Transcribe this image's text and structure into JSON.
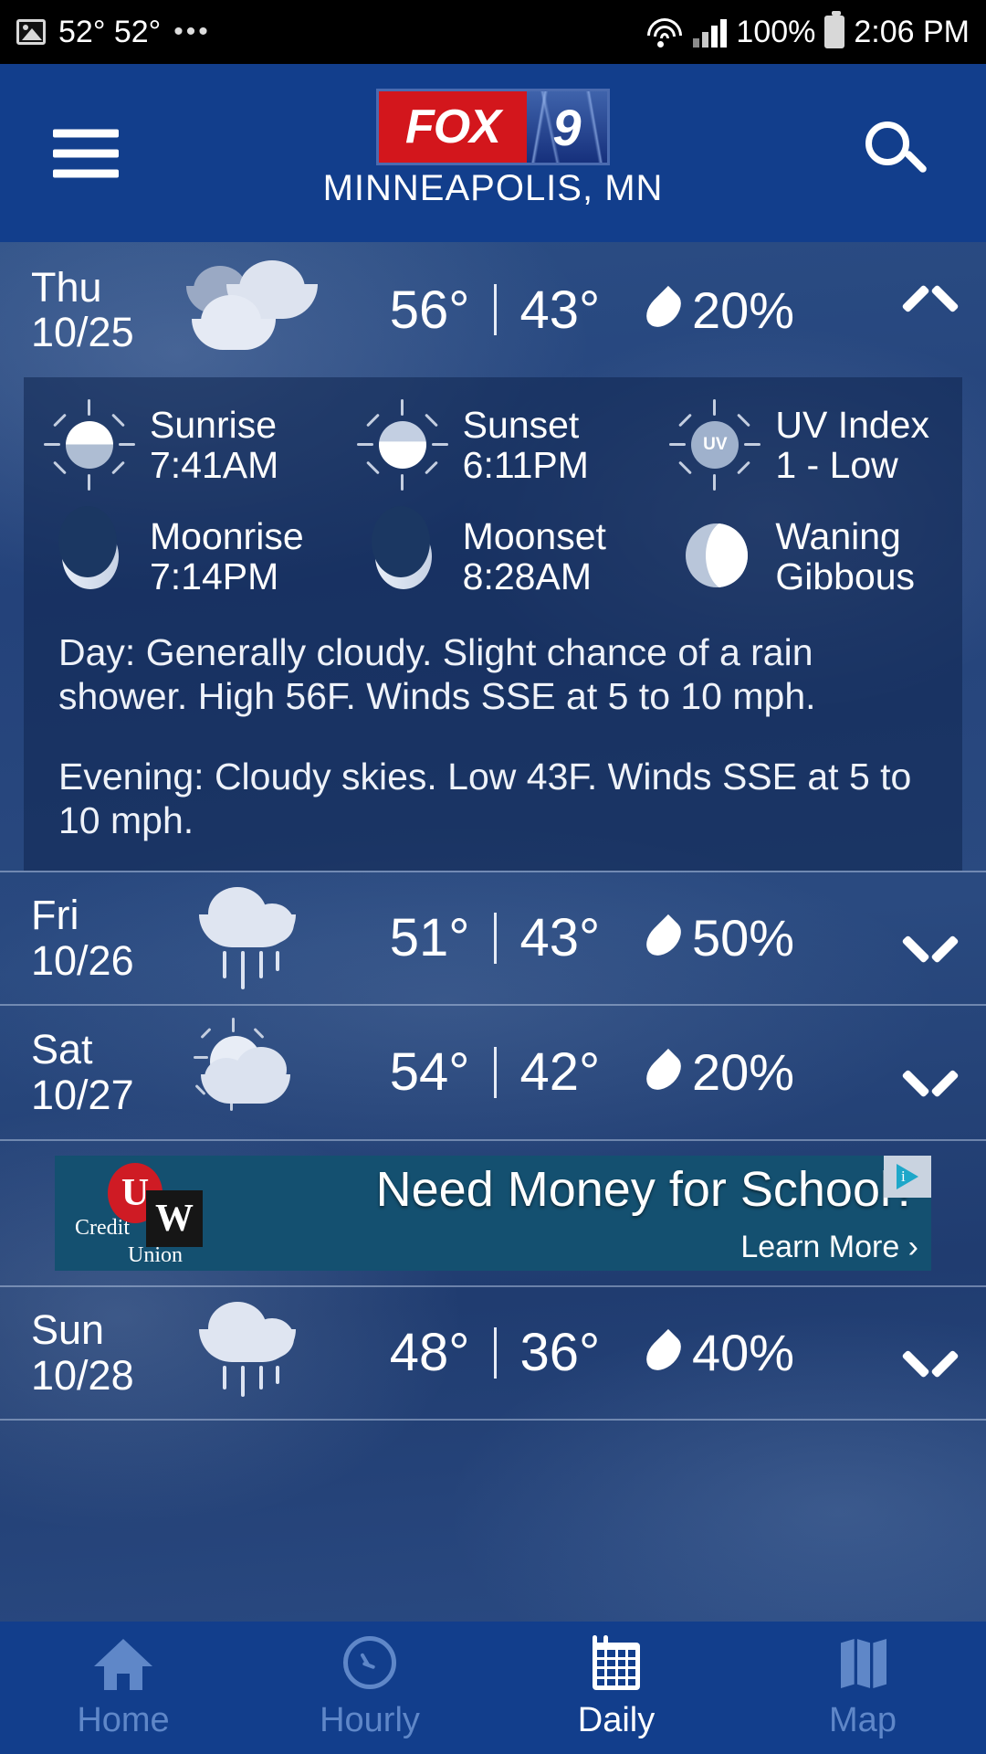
{
  "status_bar": {
    "image_icon": "image-icon",
    "temps": "52° 52°",
    "overflow": "•••",
    "wifi_icon": "wifi-icon",
    "signal_icon": "cell-signal-icon",
    "battery_percent": "100%",
    "battery_icon": "battery-icon",
    "time": "2:06 PM"
  },
  "header": {
    "menu_icon": "hamburger-menu-icon",
    "logo_fox": "FOX",
    "logo_nine": "9",
    "city": "MINNEAPOLIS, MN",
    "search_icon": "search-icon",
    "bg_color": "#123E8C"
  },
  "days": [
    {
      "dow": "Thu",
      "date": "10/25",
      "icon": "cloudy-icon",
      "high": "56°",
      "low": "43°",
      "separator": "|",
      "precip": "20%",
      "drop_icon": "water-drop-icon",
      "chevron": "chevron-up-icon",
      "expanded": true
    },
    {
      "dow": "Fri",
      "date": "10/26",
      "icon": "rain-cloud-icon",
      "high": "51°",
      "low": "43°",
      "separator": "|",
      "precip": "50%",
      "drop_icon": "water-drop-icon",
      "chevron": "chevron-down-icon",
      "expanded": false
    },
    {
      "dow": "Sat",
      "date": "10/27",
      "icon": "partly-sunny-icon",
      "high": "54°",
      "low": "42°",
      "separator": "|",
      "precip": "20%",
      "drop_icon": "water-drop-icon",
      "chevron": "chevron-down-icon",
      "expanded": false
    },
    {
      "dow": "Sun",
      "date": "10/28",
      "icon": "rain-cloud-icon",
      "high": "48°",
      "low": "36°",
      "separator": "|",
      "precip": "40%",
      "drop_icon": "water-drop-icon",
      "chevron": "chevron-down-icon",
      "expanded": false
    }
  ],
  "detail": {
    "astro": [
      {
        "label": "Sunrise",
        "value": "7:41AM",
        "icon": "sunrise-icon"
      },
      {
        "label": "Sunset",
        "value": "6:11PM",
        "icon": "sunset-icon"
      },
      {
        "label": "UV Index",
        "value": "1 - Low",
        "icon": "uv-index-icon",
        "badge": "UV"
      },
      {
        "label": "Moonrise",
        "value": "7:14PM",
        "icon": "moonrise-icon"
      },
      {
        "label": "Moonset",
        "value": "8:28AM",
        "icon": "moonset-icon"
      },
      {
        "label": "Waning",
        "value": "Gibbous",
        "icon": "moon-phase-icon"
      }
    ],
    "day_forecast": "Day: Generally cloudy. Slight chance of a rain shower. High 56F. Winds SSE at 5 to 10 mph.",
    "evening_forecast": "Evening: Cloudy skies. Low 43F. Winds SSE at 5 to 10 mph."
  },
  "ad": {
    "brand_u": "U",
    "brand_w": "W",
    "brand_credit": "Credit",
    "brand_union": "Union",
    "headline": "Need Money for School?",
    "cta": "Learn More ›",
    "adchoices_icon": "adchoices-icon",
    "bg_color": "#145070"
  },
  "bottom_nav": [
    {
      "label": "Home",
      "icon": "home-icon",
      "active": false
    },
    {
      "label": "Hourly",
      "icon": "clock-icon",
      "active": false
    },
    {
      "label": "Daily",
      "icon": "calendar-icon",
      "active": true
    },
    {
      "label": "Map",
      "icon": "map-icon",
      "active": false
    }
  ]
}
